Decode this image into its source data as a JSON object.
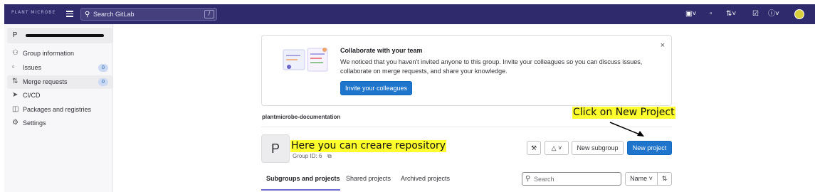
{
  "topbar": {
    "brand": "PLANT MICROBE",
    "search_placeholder": "Search GitLab",
    "search_shortcut": "/",
    "icons": [
      "issues-icon",
      "merge-request-icon",
      "todo-icon",
      "help-icon",
      "avatar"
    ]
  },
  "sidebar": {
    "group_letter": "P",
    "group_name": "plantmicrobe-documentation",
    "items": [
      {
        "label": "Group information",
        "icon": "group-icon"
      },
      {
        "label": "Issues",
        "icon": "issues-icon",
        "badge": "0"
      },
      {
        "label": "Merge requests",
        "icon": "merge-request-icon",
        "badge": "0"
      },
      {
        "label": "CI/CD",
        "icon": "rocket-icon"
      },
      {
        "label": "Packages and registries",
        "icon": "package-icon"
      },
      {
        "label": "Settings",
        "icon": "gear-icon"
      }
    ]
  },
  "alert": {
    "title": "Collaborate with your team",
    "body": "We noticed that you haven't invited anyone to this group. Invite your colleagues so you can discuss issues, collaborate on merge requests, and share your knowledge.",
    "button": "Invite your colleagues",
    "close": "×"
  },
  "main": {
    "breadcrumb": "plantmicrobe-documentation",
    "avatar_letter": "P",
    "group_id": "Group ID: 6",
    "buttons": {
      "new_subgroup": "New subgroup",
      "new_project": "New project"
    },
    "tabs": [
      "Subgroups and projects",
      "Shared projects",
      "Archived projects"
    ],
    "search_placeholder": "Search",
    "sort_label": "Name"
  },
  "annotations": {
    "repo": "Here you can creare repository",
    "click": "Click on New Project"
  },
  "colors": {
    "topbar": "#2f2a6b",
    "primary": "#1f75cb",
    "highlight": "#ffff2e"
  }
}
